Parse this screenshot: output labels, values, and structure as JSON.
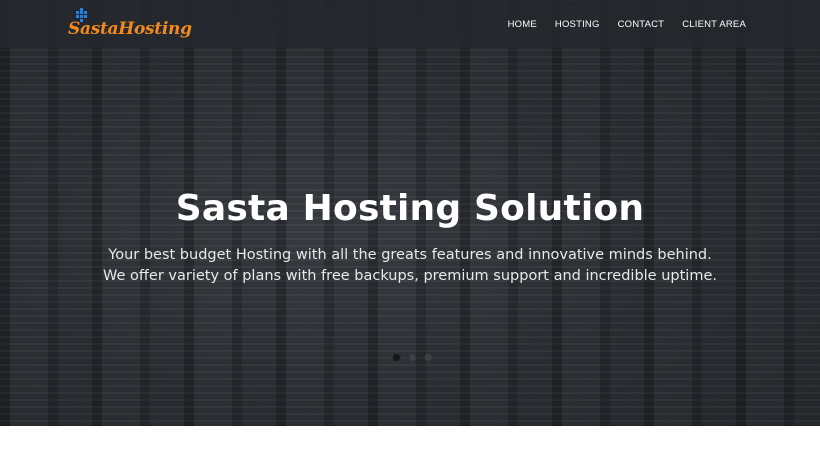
{
  "brand": {
    "name": "SastaHosting",
    "logo_icon": "grid-server-icon",
    "accent_color": "#f08a1c",
    "icon_color": "#2f7fd1"
  },
  "nav": {
    "items": [
      {
        "label": "HOME"
      },
      {
        "label": "HOSTING"
      },
      {
        "label": "CONTACT"
      },
      {
        "label": "CLIENT AREA"
      }
    ]
  },
  "hero": {
    "title": "Sasta Hosting Solution",
    "subtitle_lines": [
      "Your best budget Hosting with all the greats features and innovative minds behind.",
      "We offer variety of plans with free backups, premium support and incredible uptime."
    ],
    "slider": {
      "slide_count": 3,
      "active_index": 0
    }
  }
}
